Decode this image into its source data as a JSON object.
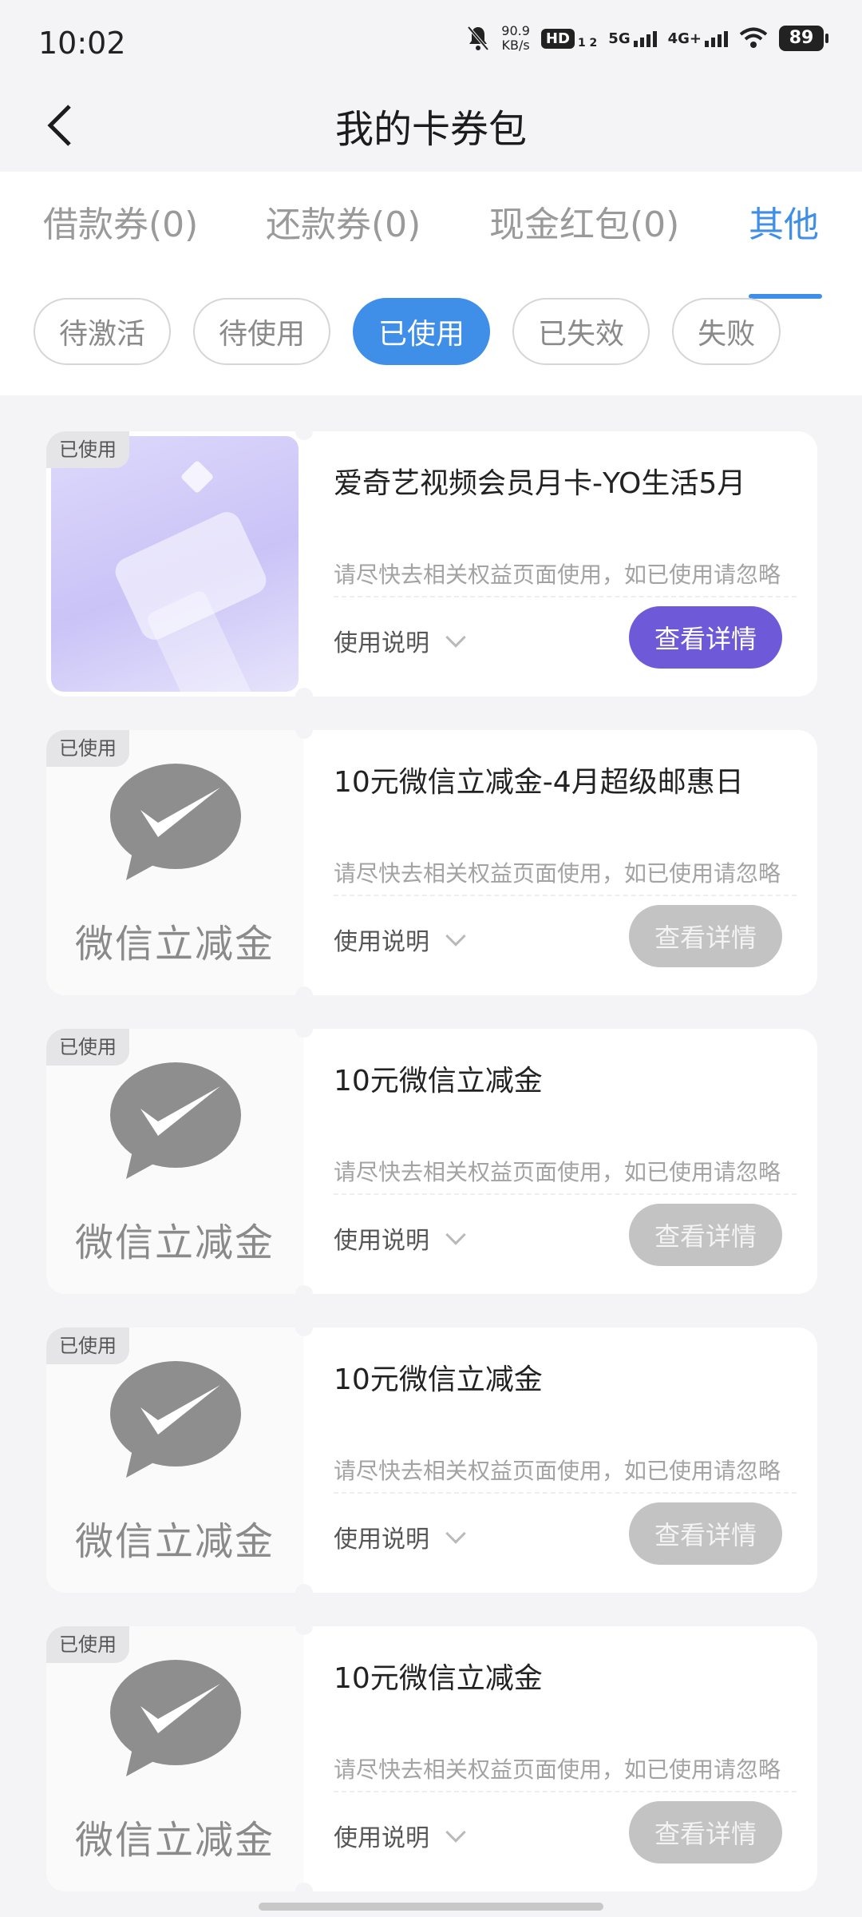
{
  "status_bar": {
    "time": "10:02",
    "net_speed_value": "90.9",
    "net_speed_unit": "KB/s",
    "hd_label": "HD",
    "hd_sub": "1 2",
    "sig1_label": "5G",
    "sig2_label": "4G+",
    "battery": "89"
  },
  "header": {
    "title": "我的卡券包"
  },
  "tabs": [
    {
      "label": "借款券(0)"
    },
    {
      "label": "还款券(0)"
    },
    {
      "label": "现金红包(0)"
    },
    {
      "label": "其他"
    }
  ],
  "chips": [
    {
      "label": "待激活"
    },
    {
      "label": "待使用"
    },
    {
      "label": "已使用"
    },
    {
      "label": "已失效"
    },
    {
      "label": "失败"
    }
  ],
  "colors": {
    "accent": "#3f8ee8",
    "purple_button": "#6e5ad8",
    "grey_button": "#c3c3c3"
  },
  "cards": [
    {
      "badge": "已使用",
      "title": "爱奇艺视频会员月卡-YO生活5月",
      "tip": "请尽快去相关权益页面使用，如已使用请忽略",
      "usage": "使用说明",
      "button": "查看详情"
    },
    {
      "badge": "已使用",
      "image_label": "微信立减金",
      "title": "10元微信立减金-4月超级邮惠日",
      "tip": "请尽快去相关权益页面使用，如已使用请忽略",
      "usage": "使用说明",
      "button": "查看详情"
    },
    {
      "badge": "已使用",
      "image_label": "微信立减金",
      "title": "10元微信立减金",
      "tip": "请尽快去相关权益页面使用，如已使用请忽略",
      "usage": "使用说明",
      "button": "查看详情"
    },
    {
      "badge": "已使用",
      "image_label": "微信立减金",
      "title": "10元微信立减金",
      "tip": "请尽快去相关权益页面使用，如已使用请忽略",
      "usage": "使用说明",
      "button": "查看详情"
    },
    {
      "badge": "已使用",
      "image_label": "微信立减金",
      "title": "10元微信立减金",
      "tip": "请尽快去相关权益页面使用，如已使用请忽略",
      "usage": "使用说明",
      "button": "查看详情"
    }
  ]
}
